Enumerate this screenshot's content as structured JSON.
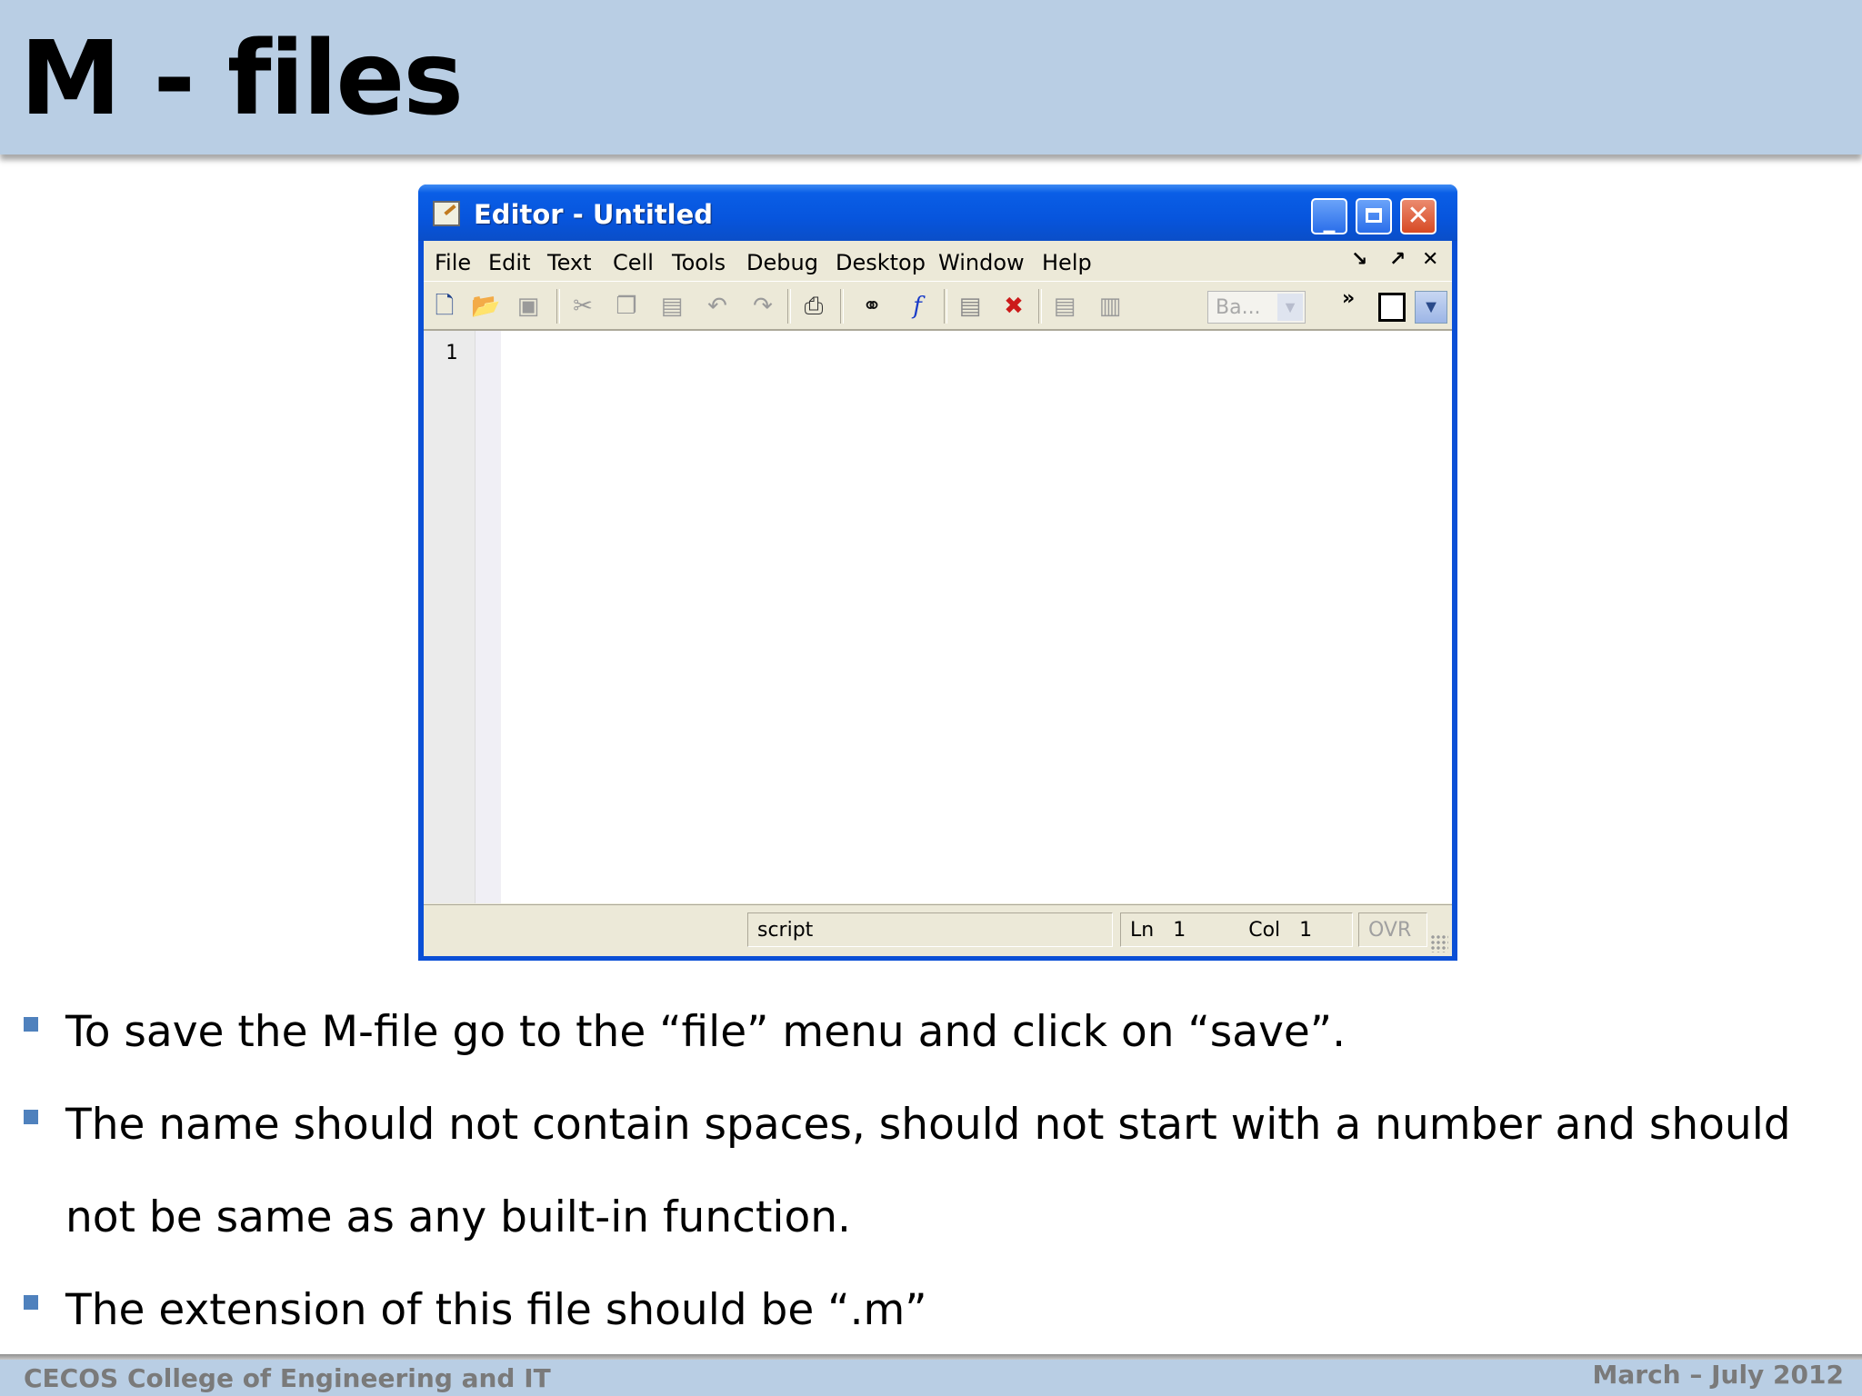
{
  "slide": {
    "title": "M - files",
    "footer_left": "CECOS College of Engineering and IT",
    "footer_right": "March – July 2012"
  },
  "window": {
    "title": "Editor - Untitled",
    "caption_buttons": [
      "minimize",
      "maximize",
      "close"
    ],
    "menu": [
      "File",
      "Edit",
      "Text",
      "Cell",
      "Tools",
      "Debug",
      "Desktop",
      "Window",
      "Help"
    ],
    "toolbar": {
      "icons": [
        "new-file-icon",
        "open-folder-icon",
        "save-disk-icon",
        "cut-icon",
        "copy-icon",
        "paste-icon",
        "undo-icon",
        "redo-icon",
        "print-icon",
        "find-binoculars-icon",
        "function-icon",
        "breakpoint-icon",
        "clear-breakpoint-icon",
        "step-icon",
        "stack-icon"
      ],
      "combo_value": "Ba...",
      "more": "»"
    },
    "editor": {
      "line_numbers": [
        "1"
      ],
      "content": ""
    },
    "status": {
      "mode": "script",
      "ln_label": "Ln",
      "ln_value": "1",
      "col_label": "Col",
      "col_value": "1",
      "ovr": "OVR"
    }
  },
  "bullets": [
    "To save the M-file go to the “file” menu and click on “save”.",
    "The name should not contain spaces, should not start with a number and should not be same as any built-in function.",
    "The extension of this file should be “.m”"
  ]
}
